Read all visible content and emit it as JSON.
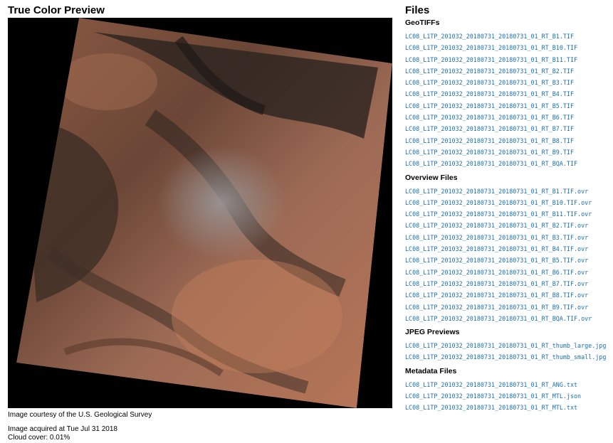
{
  "preview": {
    "title": "True Color Preview",
    "caption": "Image courtesy of the U.S. Geological Survey",
    "acquired": "Image acquired at Tue Jul 31 2018",
    "cloud": "Cloud cover: 0.01%"
  },
  "files": {
    "title": "Files",
    "sections": [
      {
        "heading": "GeoTIFFs",
        "items": [
          "LC08_L1TP_201032_20180731_20180731_01_RT_B1.TIF",
          "LC08_L1TP_201032_20180731_20180731_01_RT_B10.TIF",
          "LC08_L1TP_201032_20180731_20180731_01_RT_B11.TIF",
          "LC08_L1TP_201032_20180731_20180731_01_RT_B2.TIF",
          "LC08_L1TP_201032_20180731_20180731_01_RT_B3.TIF",
          "LC08_L1TP_201032_20180731_20180731_01_RT_B4.TIF",
          "LC08_L1TP_201032_20180731_20180731_01_RT_B5.TIF",
          "LC08_L1TP_201032_20180731_20180731_01_RT_B6.TIF",
          "LC08_L1TP_201032_20180731_20180731_01_RT_B7.TIF",
          "LC08_L1TP_201032_20180731_20180731_01_RT_B8.TIF",
          "LC08_L1TP_201032_20180731_20180731_01_RT_B9.TIF",
          "LC08_L1TP_201032_20180731_20180731_01_RT_BQA.TIF"
        ]
      },
      {
        "heading": "Overview Files",
        "items": [
          "LC08_L1TP_201032_20180731_20180731_01_RT_B1.TIF.ovr",
          "LC08_L1TP_201032_20180731_20180731_01_RT_B10.TIF.ovr",
          "LC08_L1TP_201032_20180731_20180731_01_RT_B11.TIF.ovr",
          "LC08_L1TP_201032_20180731_20180731_01_RT_B2.TIF.ovr",
          "LC08_L1TP_201032_20180731_20180731_01_RT_B3.TIF.ovr",
          "LC08_L1TP_201032_20180731_20180731_01_RT_B4.TIF.ovr",
          "LC08_L1TP_201032_20180731_20180731_01_RT_B5.TIF.ovr",
          "LC08_L1TP_201032_20180731_20180731_01_RT_B6.TIF.ovr",
          "LC08_L1TP_201032_20180731_20180731_01_RT_B7.TIF.ovr",
          "LC08_L1TP_201032_20180731_20180731_01_RT_B8.TIF.ovr",
          "LC08_L1TP_201032_20180731_20180731_01_RT_B9.TIF.ovr",
          "LC08_L1TP_201032_20180731_20180731_01_RT_BQA.TIF.ovr"
        ]
      },
      {
        "heading": "JPEG Previews",
        "items": [
          "LC08_L1TP_201032_20180731_20180731_01_RT_thumb_large.jpg",
          "LC08_L1TP_201032_20180731_20180731_01_RT_thumb_small.jpg"
        ]
      },
      {
        "heading": "Metadata Files",
        "items": [
          "LC08_L1TP_201032_20180731_20180731_01_RT_ANG.txt",
          "LC08_L1TP_201032_20180731_20180731_01_RT_MTL.json",
          "LC08_L1TP_201032_20180731_20180731_01_RT_MTL.txt"
        ]
      }
    ]
  }
}
